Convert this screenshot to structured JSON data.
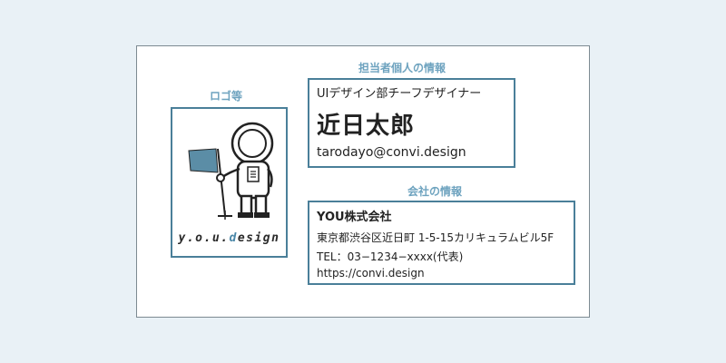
{
  "labels": {
    "logo": "ロゴ等",
    "personal": "担当者個人の情報",
    "company": "会社の情報"
  },
  "logo": {
    "text_prefix": "y.o.u.",
    "text_accent": "d",
    "text_suffix": "esign",
    "icon": "astronaut-with-flag-icon"
  },
  "personal": {
    "title": "UIデザイン部チーフデザイナー",
    "name": "近日太郎",
    "email": "tarodayo@convi.design"
  },
  "company": {
    "name": "YOU株式会社",
    "address": "東京都渋谷区近日町 1-5-15カリキュラムビル5F",
    "tel": "TEL：03−1234−xxxx(代表)",
    "url": "https://convi.design"
  },
  "colors": {
    "background": "#e9f1f6",
    "accent": "#4a7f99",
    "label": "#6ea3bf",
    "flag": "#5b8da6"
  }
}
